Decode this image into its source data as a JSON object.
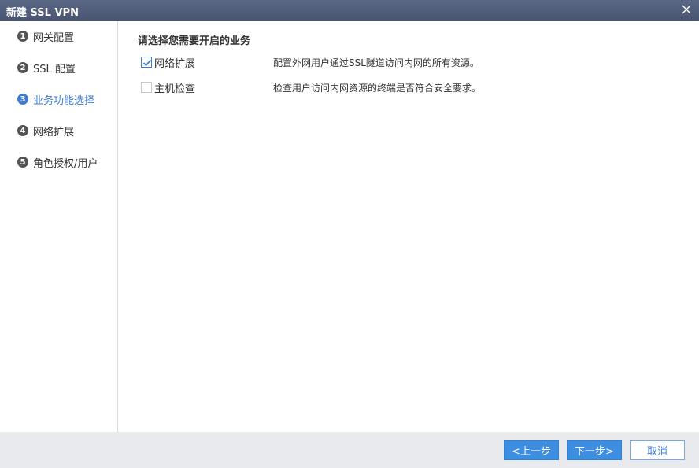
{
  "window": {
    "title": "新建 SSL VPN"
  },
  "steps": [
    {
      "num": "1",
      "label": "网关配置"
    },
    {
      "num": "2",
      "label": "SSL 配置"
    },
    {
      "num": "3",
      "label": "业务功能选择"
    },
    {
      "num": "4",
      "label": "网络扩展"
    },
    {
      "num": "5",
      "label": "角色授权/用户"
    }
  ],
  "main": {
    "heading": "请选择您需要开启的业务",
    "options": [
      {
        "label": "网络扩展",
        "checked": true,
        "description": "配置外网用户通过SSL隧道访问内网的所有资源。"
      },
      {
        "label": "主机检查",
        "checked": false,
        "description": "检查用户访问内网资源的终端是否符合安全要求。"
      }
    ]
  },
  "footer": {
    "prev_label": "<上一步",
    "next_label": "下一步>",
    "cancel_label": "取消"
  },
  "colors": {
    "accent": "#3d7cd6",
    "titlebar": "#4e5a76"
  }
}
